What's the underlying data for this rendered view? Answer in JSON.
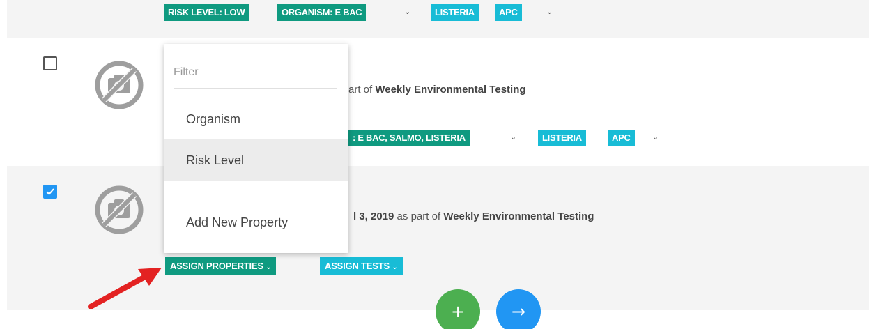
{
  "rows": [
    {
      "id": "row-1",
      "tags_properties": [
        "RISK LEVEL: LOW",
        "ORGANISM: E BAC"
      ],
      "tags_tests": [
        "LISTERIA",
        "APC"
      ]
    },
    {
      "id": "row-2",
      "checked": false,
      "description_prefix": "art of ",
      "description_bold": "Weekly Environmental Testing",
      "tags_properties": [
        ": E BAC, SALMO, LISTERIA"
      ],
      "tags_tests": [
        "LISTERIA",
        "APC"
      ]
    },
    {
      "id": "row-3",
      "checked": true,
      "date_fragment": "l 3, 2019",
      "description_mid": " as part of ",
      "description_bold": "Weekly Environmental Testing",
      "assign_properties_label": "ASSIGN PROPERTIES",
      "assign_tests_label": "ASSIGN TESTS"
    }
  ],
  "dropdown": {
    "filter_placeholder": "Filter",
    "items": [
      "Organism",
      "Risk Level"
    ],
    "active_item": "Risk Level",
    "add_new_label": "Add New Property"
  },
  "fabs": {
    "add_symbol": "+",
    "next_symbol": "→"
  },
  "colors": {
    "green": "#0f9a80",
    "cyan": "#18bcd6",
    "fab_green": "#4caf50",
    "fab_blue": "#2196f3",
    "annotation_arrow": "#e32222"
  }
}
